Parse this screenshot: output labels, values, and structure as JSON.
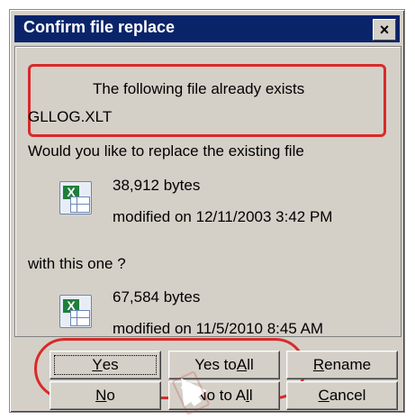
{
  "dialog": {
    "title": "Confirm file replace",
    "close_icon": "close-icon"
  },
  "content": {
    "line1": "The following file already exists",
    "filename": "GLLOG.XLT",
    "question": "Would you like to replace the existing file",
    "existing": {
      "size": "38,912 bytes",
      "modified": "modified on 12/11/2003 3:42 PM"
    },
    "with_text": "with this one ?",
    "new": {
      "size": "67,584 bytes",
      "modified": "modified on 11/5/2010 8:45 AM"
    }
  },
  "buttons": {
    "yes": {
      "prefix": "",
      "key": "Y",
      "suffix": "es"
    },
    "yes_to_all": {
      "prefix": "Yes to ",
      "key": "A",
      "suffix": "ll"
    },
    "rename": {
      "prefix": "",
      "key": "R",
      "suffix": "ename"
    },
    "no": {
      "prefix": "",
      "key": "N",
      "suffix": "o"
    },
    "no_to_all": {
      "prefix": "No to A",
      "key": "l",
      "suffix": "l"
    },
    "cancel": {
      "prefix": "",
      "key": "C",
      "suffix": "ancel"
    }
  },
  "colors": {
    "titlebar": "#0a246a",
    "annotation": "#d92a2a",
    "dialog_bg": "#d4d0c8"
  }
}
